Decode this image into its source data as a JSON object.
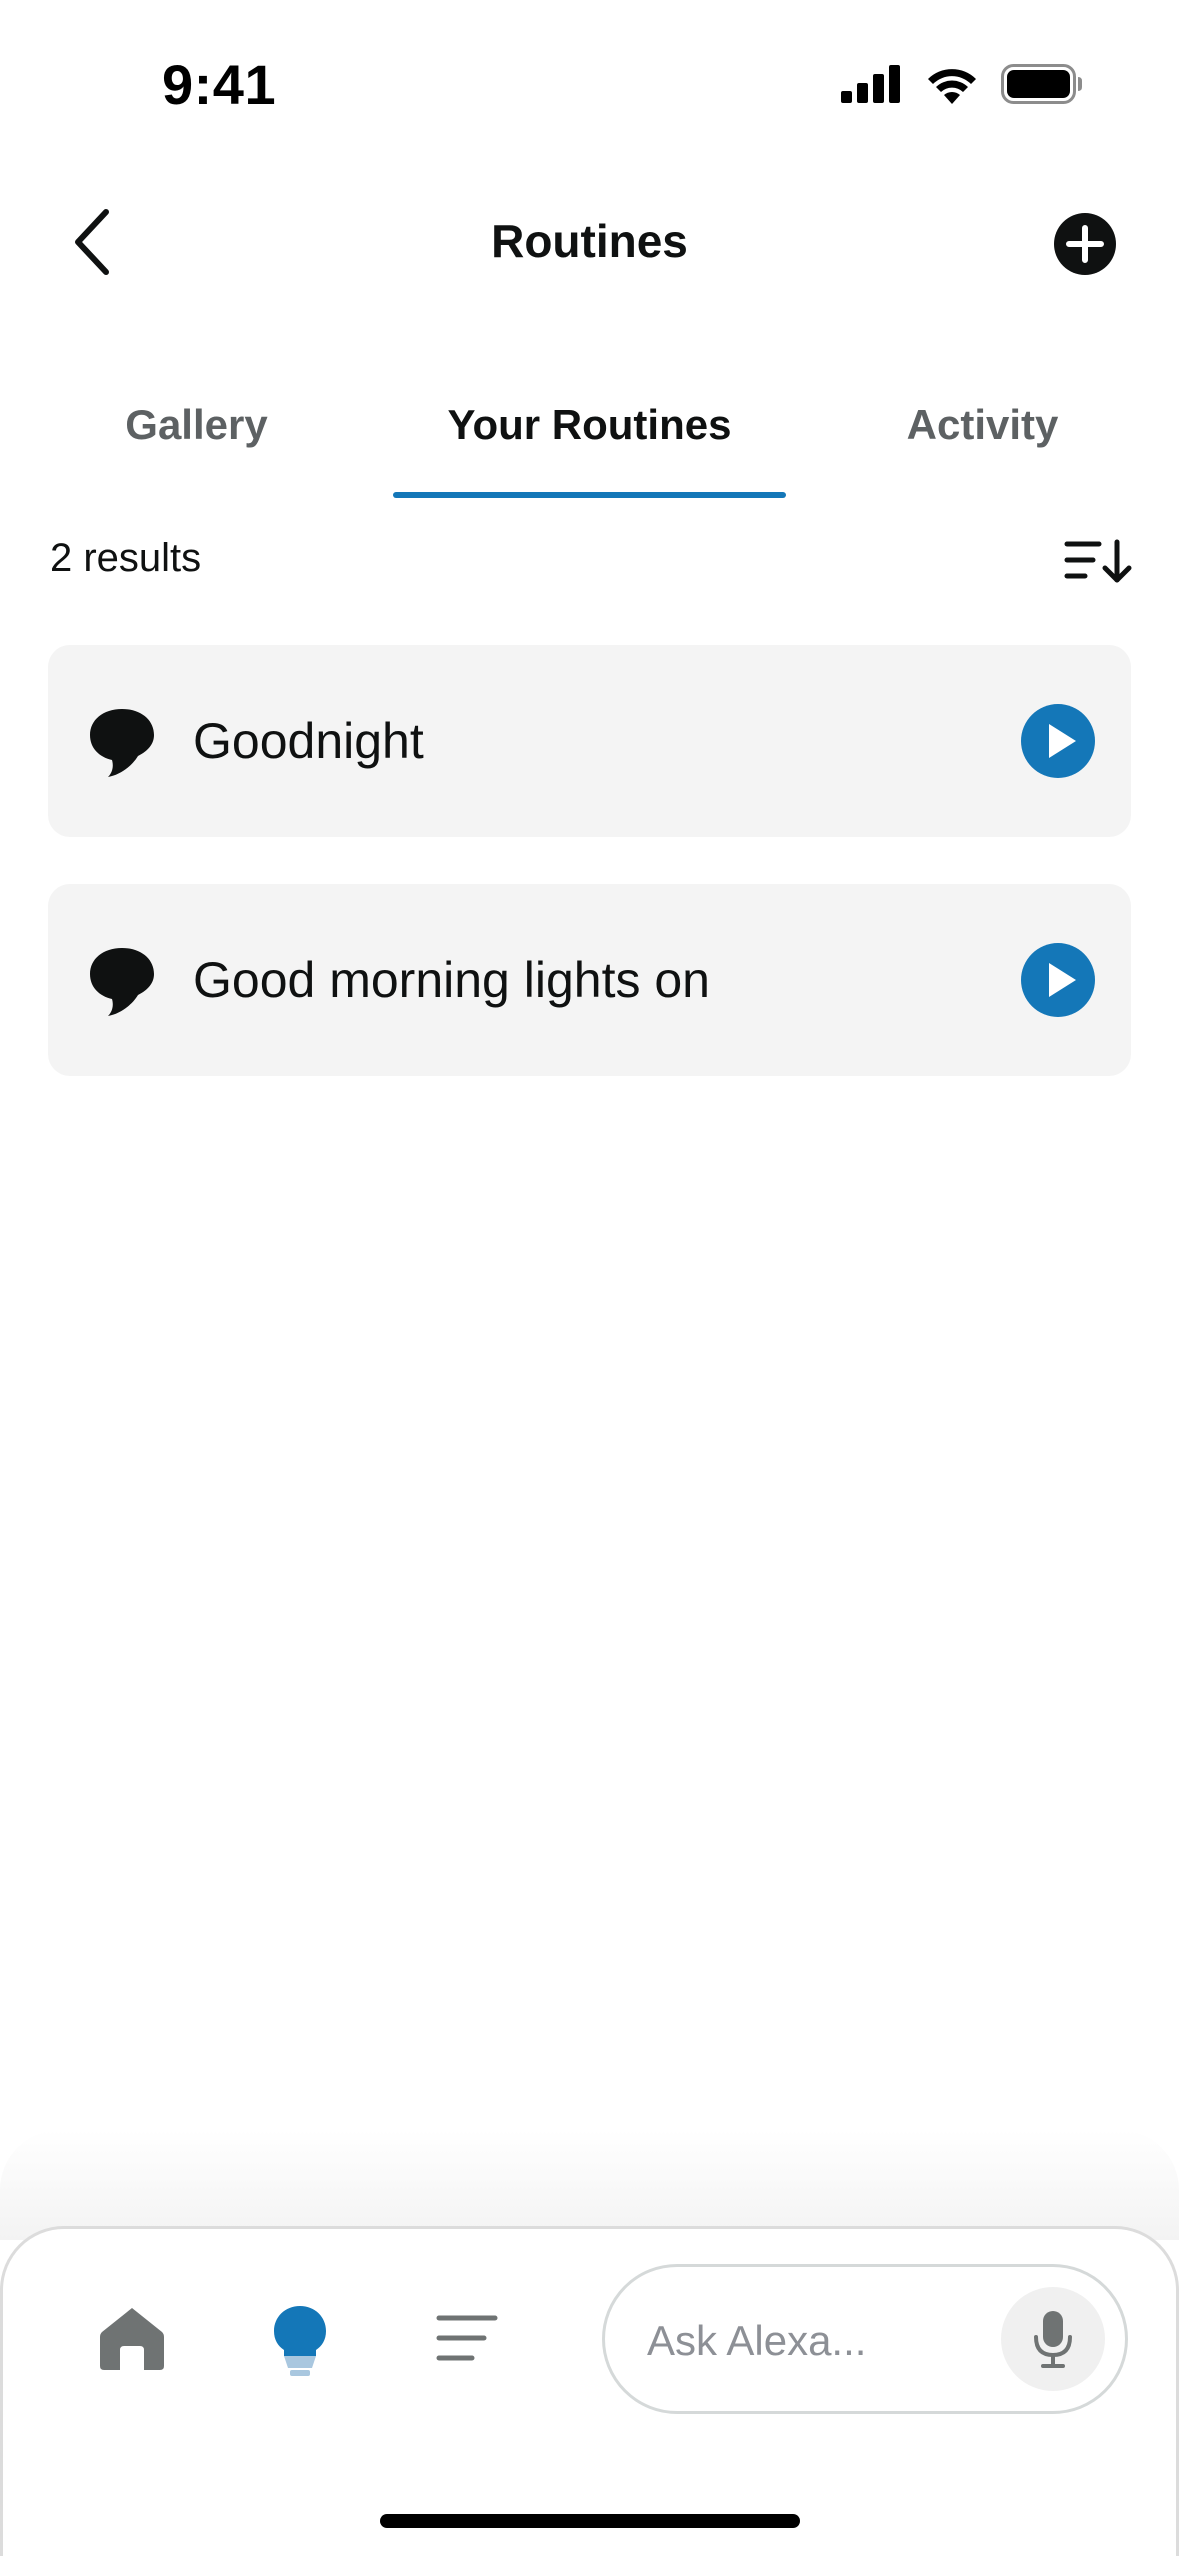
{
  "status_bar": {
    "time": "9:41"
  },
  "header": {
    "title": "Routines",
    "back_icon": "chevron-left-icon",
    "add_icon": "plus-circle-icon"
  },
  "tabs": [
    {
      "label": "Gallery",
      "active": false
    },
    {
      "label": "Your Routines",
      "active": true
    },
    {
      "label": "Activity",
      "active": false
    }
  ],
  "results": {
    "count_text": "2 results",
    "sort_icon": "sort-descending-icon"
  },
  "routines": [
    {
      "name": "Goodnight",
      "icon": "speech-bubble-icon",
      "action_icon": "play-icon"
    },
    {
      "name": "Good morning lights on",
      "icon": "speech-bubble-icon",
      "action_icon": "play-icon"
    }
  ],
  "bottom_nav": {
    "items": [
      {
        "name": "home",
        "icon": "home-icon",
        "active": false
      },
      {
        "name": "devices",
        "icon": "lightbulb-icon",
        "active": true
      },
      {
        "name": "more",
        "icon": "menu-lines-icon",
        "active": false
      }
    ],
    "ask_placeholder": "Ask Alexa...",
    "mic_icon": "microphone-icon"
  },
  "colors": {
    "accent": "#1477b8",
    "card_background": "#f4f4f4",
    "text_primary": "#0f1111",
    "text_secondary": "#5d6163"
  }
}
